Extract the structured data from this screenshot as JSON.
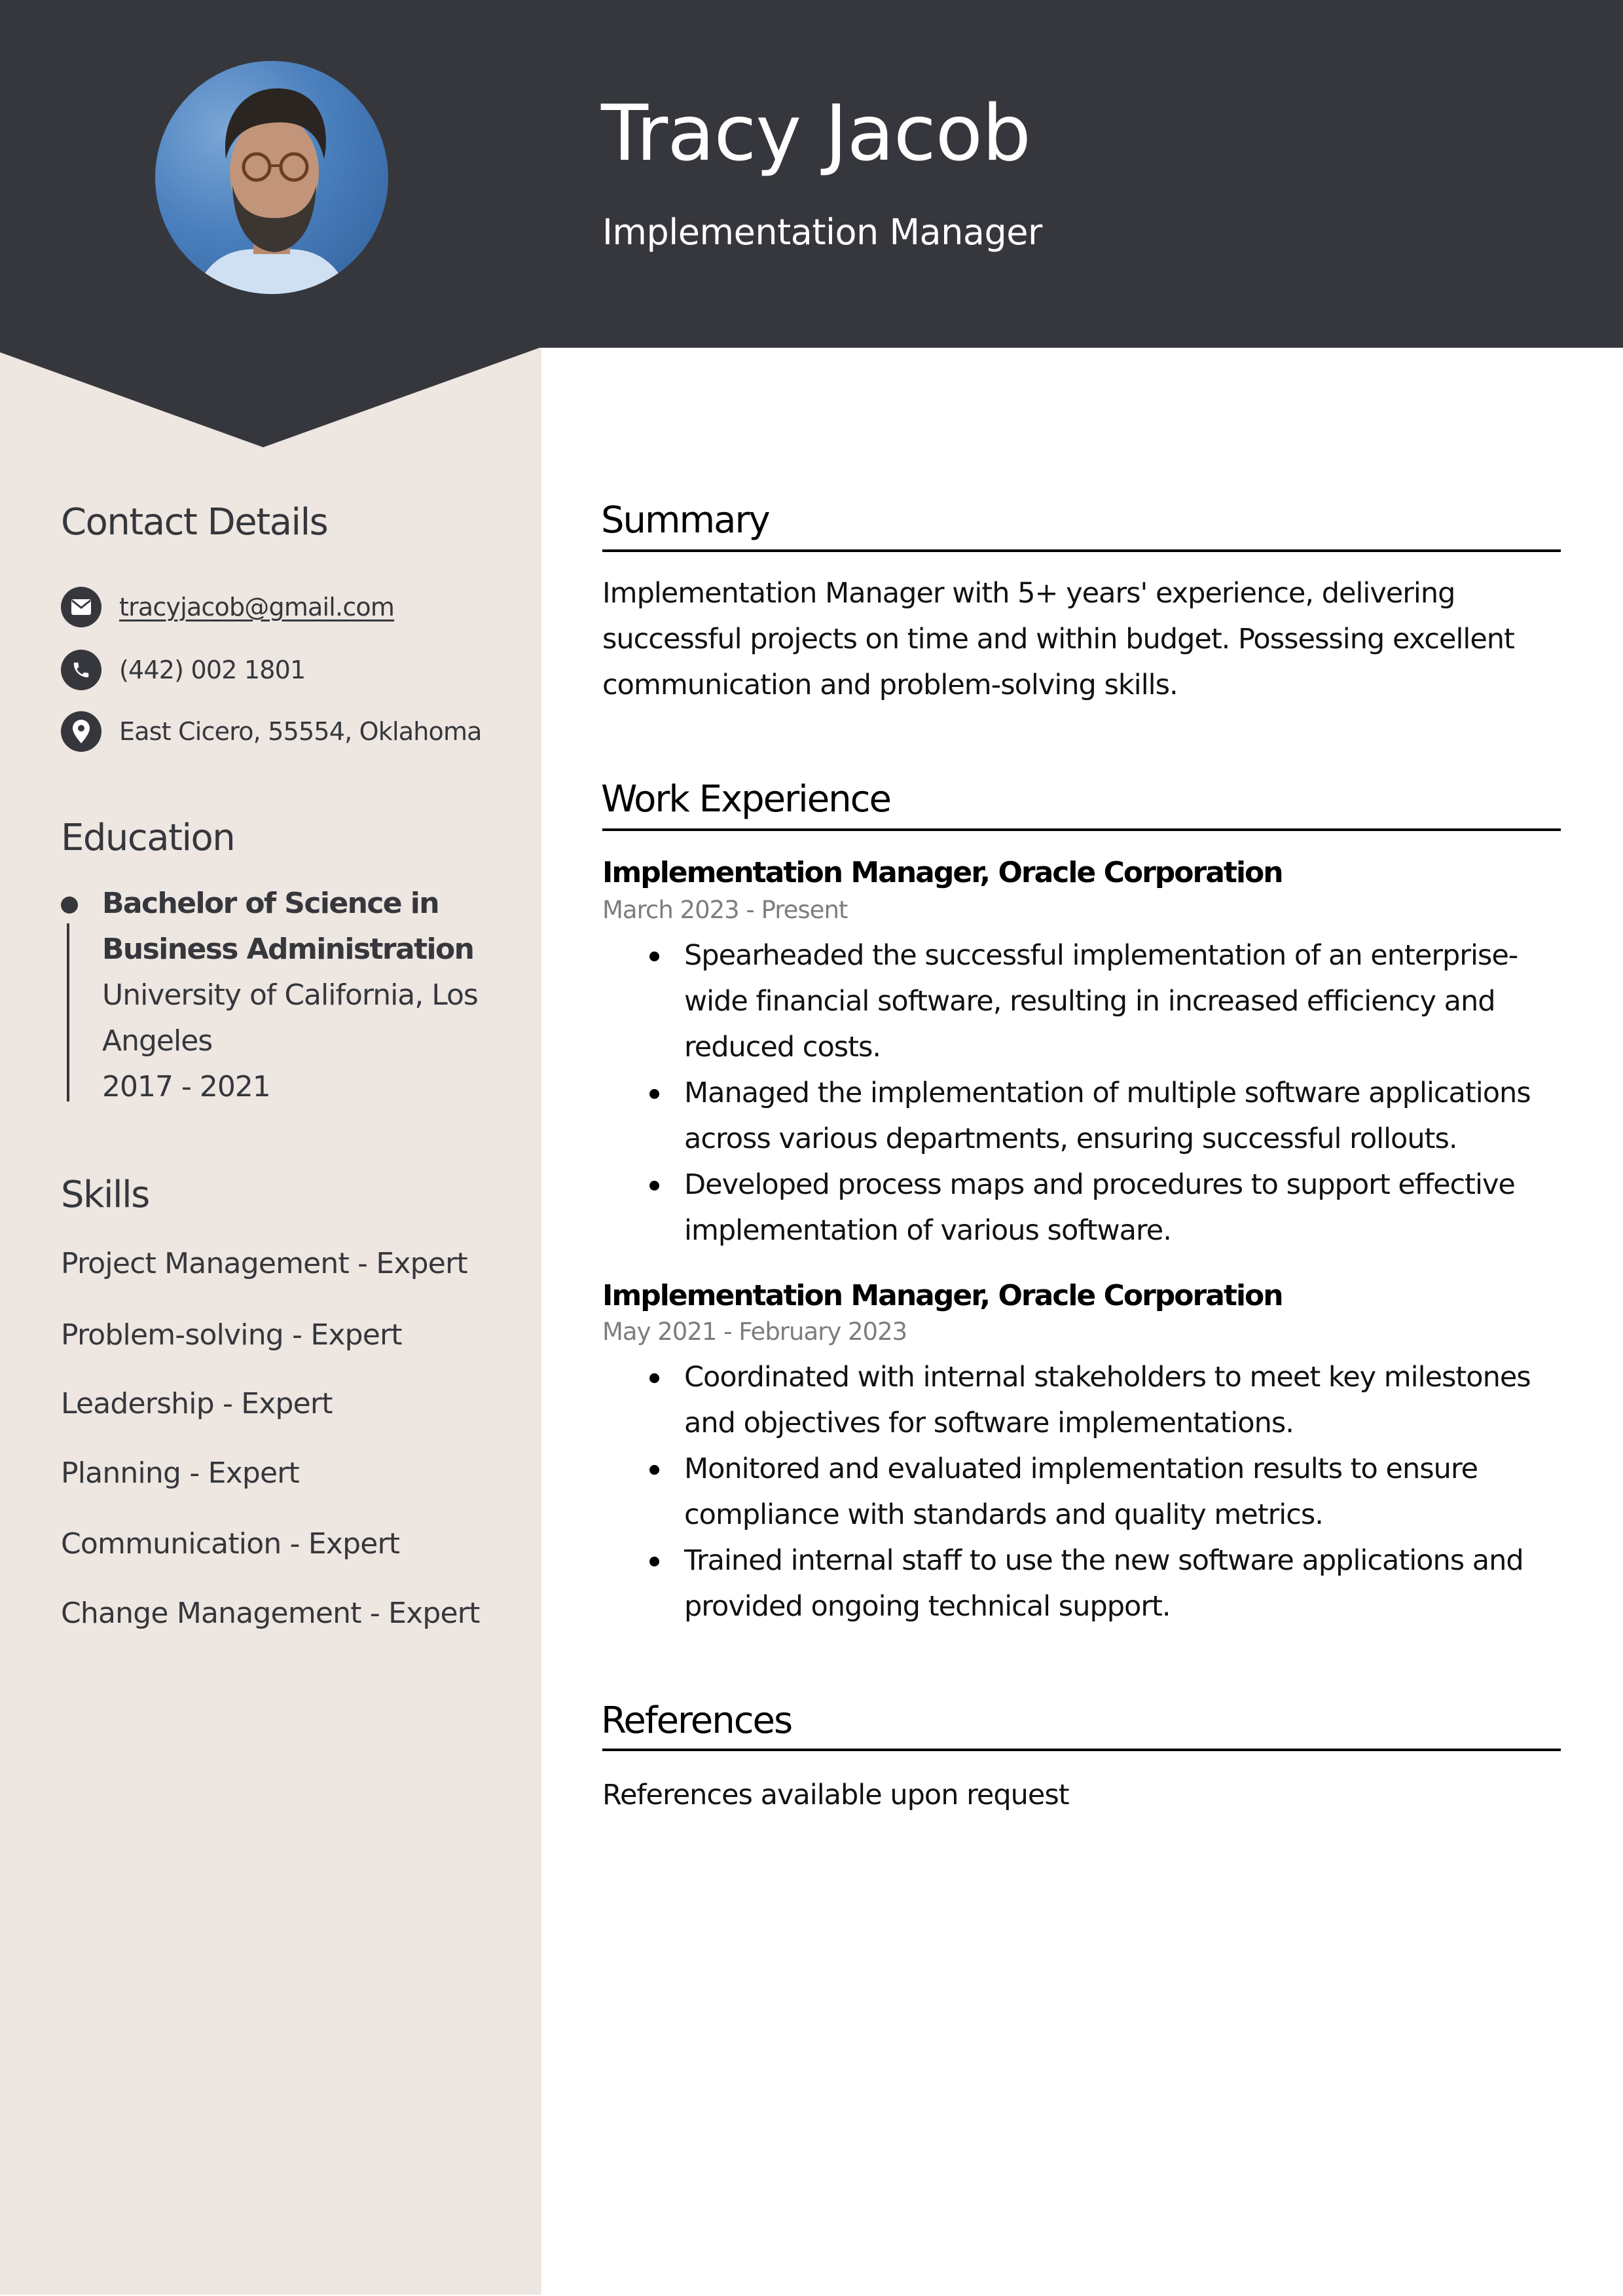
{
  "colors": {
    "header_bg": "#36373c",
    "sidebar_bg": "#ede6e1",
    "text_dark": "#36373c",
    "date_grey": "#7d7d7d"
  },
  "header": {
    "name": "Tracy Jacob",
    "title": "Implementation Manager",
    "photo_alt": "Profile photo of Tracy Jacob"
  },
  "sidebar": {
    "contact": {
      "heading": "Contact Details",
      "email": {
        "icon": "envelope-icon",
        "value": "tracyjacob@gmail.com"
      },
      "phone": {
        "icon": "phone-icon",
        "value": "(442) 002 1801"
      },
      "address": {
        "icon": "map-pin-icon",
        "value": "East Cicero, 55554, Oklahoma"
      }
    },
    "education": {
      "heading": "Education",
      "items": [
        {
          "degree_line1": "Bachelor of Science in",
          "degree_line2": "Business Administration",
          "school_line1": "University of California, Los",
          "school_line2": "Angeles",
          "years": "2017 - 2021"
        }
      ]
    },
    "skills": {
      "heading": "Skills",
      "items": [
        "Project Management - Expert",
        "Problem-solving - Expert",
        "Leadership - Expert",
        "Planning - Expert",
        "Communication - Expert",
        "Change Management - Expert"
      ]
    }
  },
  "main": {
    "summary": {
      "heading": "Summary",
      "text": "Implementation Manager with 5+ years' experience, delivering successful projects on time and within budget. Possessing excellent communication and problem-solving skills."
    },
    "experience": {
      "heading": "Work Experience",
      "jobs": [
        {
          "title": "Implementation Manager, Oracle Corporation",
          "dates": "March 2023 - Present",
          "bullets": [
            "Spearheaded the successful implementation of an enterprise-wide financial software, resulting in increased efficiency and reduced costs.",
            "Managed the implementation of multiple software applications across various departments, ensuring successful rollouts.",
            "Developed process maps and procedures to support effective implementation of various software."
          ]
        },
        {
          "title": "Implementation Manager, Oracle Corporation",
          "dates": "May 2021 - February 2023",
          "bullets": [
            "Coordinated with internal stakeholders to meet key milestones and objectives for software implementations.",
            "Monitored and evaluated implementation results to ensure compliance with standards and quality metrics.",
            "Trained internal staff to use the new software applications and provided ongoing technical support."
          ]
        }
      ]
    },
    "references": {
      "heading": "References",
      "text": "References available upon request"
    }
  }
}
